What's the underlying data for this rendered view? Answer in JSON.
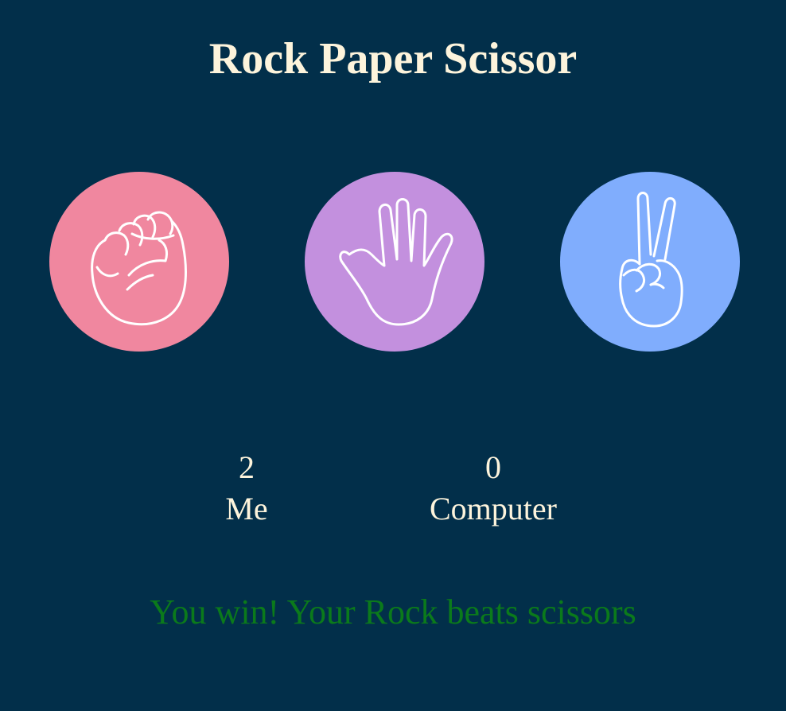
{
  "game": {
    "title": "Rock Paper Scissor"
  },
  "choices": [
    {
      "id": "rock",
      "icon": "fist-icon",
      "color": "#f0879f"
    },
    {
      "id": "paper",
      "icon": "open-hand-icon",
      "color": "#c390de"
    },
    {
      "id": "scissors",
      "icon": "peace-hand-icon",
      "color": "#80adfd"
    }
  ],
  "scoreboard": {
    "user": {
      "score": "2",
      "label": "Me"
    },
    "computer": {
      "score": "0",
      "label": "Computer"
    }
  },
  "message": {
    "text": "You win! Your Rock beats scissors",
    "color": "#0b7a1b"
  },
  "colors": {
    "background": "#022f4a",
    "text": "#fdf4dc"
  }
}
